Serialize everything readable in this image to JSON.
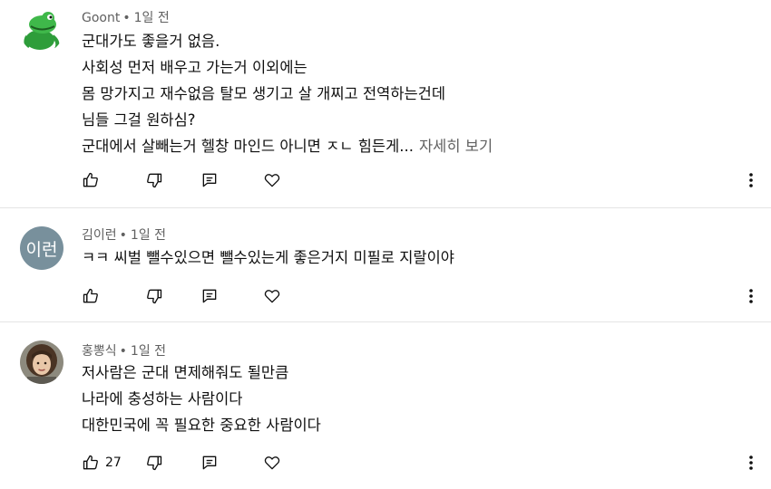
{
  "comments": [
    {
      "author": "Goont",
      "time": "1일 전",
      "lines": [
        "군대가도 좋을거 없음.",
        "사회성 먼저 배우고 가는거 이외에는",
        "몸 망가지고 재수없음 탈모 생기고 살 개찌고 전역하는건데",
        "님들 그걸 원하심?",
        "군대에서 살빼는거 헬창 마인드 아니면 ㅈㄴ 힘든게..."
      ],
      "read_more": "자세히 보기",
      "likes": "",
      "avatar": "green-cartoon-avatar"
    },
    {
      "author": "김이런",
      "time": "1일 전",
      "lines": [
        "ㅋㅋ 씨벌 뺄수있으면 뺄수있는게 좋은거지 미필로 지랄이야"
      ],
      "likes": "",
      "avatar_initial": "이런",
      "avatar_color": "#78909c"
    },
    {
      "author": "홍뽕식",
      "time": "1일 전",
      "lines": [
        "저사람은 군대 면제해줘도 될만큼",
        "나라에 충성하는 사람이다",
        "대한민국에 꼭 필요한 중요한 사람이다"
      ],
      "likes": "27",
      "avatar": "photo-avatar"
    }
  ],
  "meta_separator": "•",
  "icons": [
    "thumb-up-icon",
    "thumb-down-icon",
    "reply-icon",
    "heart-icon",
    "more-vert-icon"
  ]
}
